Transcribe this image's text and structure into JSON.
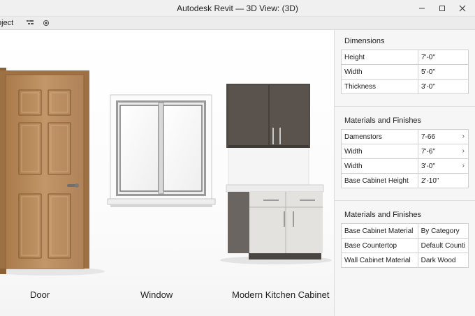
{
  "window": {
    "title": "Autodesk Revit — 3D View: (3D)"
  },
  "toolbar": {
    "label": "oject"
  },
  "icons": {
    "minimize": "minimize-icon",
    "maximize": "maximize-icon",
    "close": "close-icon",
    "toolbar_1": "tree-icon",
    "toolbar_2": "record-icon"
  },
  "viewport": {
    "labels": {
      "door": "Door",
      "window": "Window",
      "cabinet": "Modern Kitchen Cabinet"
    }
  },
  "panel": {
    "dimensions": {
      "title": "Dimensions",
      "rows": [
        {
          "name": "Height",
          "value": "7'-0\""
        },
        {
          "name": "Width",
          "value": "5'-0\""
        },
        {
          "name": "Thickness",
          "value": "3'-0\""
        }
      ]
    },
    "materials1": {
      "title": "Materials and Finishes",
      "rows": [
        {
          "name": "Damenstors",
          "value": "7-66"
        },
        {
          "name": "Width",
          "value": "7'-6\""
        },
        {
          "name": "Width",
          "value": "3'-0\""
        },
        {
          "name": "Base Cabinet Height",
          "value": "2'-10\""
        }
      ]
    },
    "materials2": {
      "title": "Materials and Finishes",
      "rows": [
        {
          "name": "Base Cabinet Material",
          "value": "By Category"
        },
        {
          "name": "Base Countertop",
          "value": "Default Counti"
        },
        {
          "name": "Wall Cabinet Material",
          "value": "Dark Wood"
        }
      ]
    }
  },
  "colors": {
    "door_wood": "#b98c5e",
    "cabinet_dark": "#5a524c",
    "cabinet_light": "#e4e2df"
  }
}
